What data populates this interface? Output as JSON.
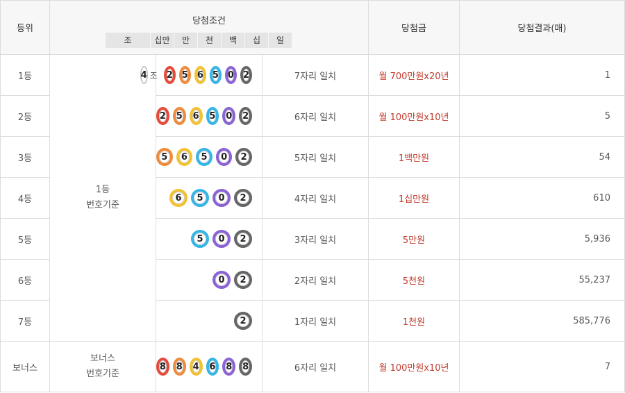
{
  "header": {
    "rank": "등위",
    "condition": "당첨조건",
    "prize": "당첨금",
    "result": "당첨결과(매)",
    "positions": [
      "조",
      "십만",
      "만",
      "천",
      "백",
      "십",
      "일"
    ]
  },
  "basis_first": "1등\n번호기준",
  "basis_bonus": "보너스\n번호기준",
  "jo_unit": "조",
  "rows": [
    {
      "rank": "1등",
      "match": "7자리 일치",
      "prize": "월 700만원x20년",
      "result": "1"
    },
    {
      "rank": "2등",
      "match": "6자리 일치",
      "prize": "월 100만원x10년",
      "result": "5"
    },
    {
      "rank": "3등",
      "match": "5자리 일치",
      "prize": "1백만원",
      "result": "54"
    },
    {
      "rank": "4등",
      "match": "4자리 일치",
      "prize": "1십만원",
      "result": "610"
    },
    {
      "rank": "5등",
      "match": "3자리 일치",
      "prize": "5만원",
      "result": "5,936"
    },
    {
      "rank": "6등",
      "match": "2자리 일치",
      "prize": "5천원",
      "result": "55,237"
    },
    {
      "rank": "7등",
      "match": "1자리 일치",
      "prize": "1천원",
      "result": "585,776"
    },
    {
      "rank": "보너스",
      "match": "6자리 일치",
      "prize": "월 100만원x10년",
      "result": "7"
    }
  ],
  "balls": {
    "row1_group": "4",
    "row1": [
      "2",
      "5",
      "6",
      "5",
      "0",
      "2"
    ],
    "row2": [
      "2",
      "5",
      "6",
      "5",
      "0",
      "2"
    ],
    "row3": [
      "5",
      "6",
      "5",
      "0",
      "2"
    ],
    "row4": [
      "6",
      "5",
      "0",
      "2"
    ],
    "row5": [
      "5",
      "0",
      "2"
    ],
    "row6": [
      "0",
      "2"
    ],
    "row7": [
      "2"
    ],
    "bonus": [
      "8",
      "8",
      "4",
      "6",
      "8",
      "8"
    ]
  },
  "ball_colors": {
    "red": "#e64a3b",
    "orange": "#ef8b3a",
    "yellow": "#f1c232",
    "blue": "#35b6e6",
    "purple": "#8b63d6",
    "gray": "#666666"
  }
}
